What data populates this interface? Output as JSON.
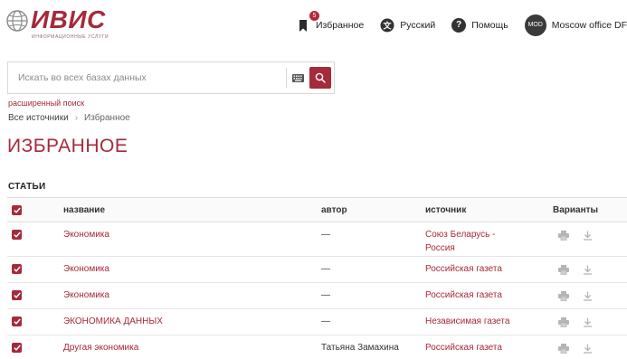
{
  "header": {
    "logo_text": "ИВИС",
    "logo_subtitle": "информационные услуги",
    "favorites_label": "Избранное",
    "favorites_count": "5",
    "language_label": "Русский",
    "help_label": "Помощь",
    "avatar_initials": "MOD",
    "user_label": "Moscow office DF"
  },
  "search": {
    "placeholder": "Искать во всех базах данных",
    "advanced_link": "расширенный поиск"
  },
  "breadcrumb": {
    "root": "Все источники",
    "current": "Избранное"
  },
  "page_title": "ИЗБРАННОЕ",
  "section_title": "СТАТЬИ",
  "table": {
    "columns": {
      "title": "название",
      "author": "автор",
      "source": "источник",
      "variants": "Варианты"
    },
    "rows": [
      {
        "title": "Экономика",
        "author": "—",
        "source": "Союз Беларусь - Россия",
        "checked": true
      },
      {
        "title": "Экономика",
        "author": "—",
        "source": "Российская газета",
        "checked": true
      },
      {
        "title": "Экономика",
        "author": "—",
        "source": "Российская газета",
        "checked": true
      },
      {
        "title": "ЭКОНОМИКА ДАННЫХ",
        "author": "—",
        "source": "Независимая газета",
        "checked": true
      },
      {
        "title": "Другая экономика",
        "author": "Татьяна Замахина",
        "source": "Российская газета",
        "checked": true
      }
    ]
  },
  "colors": {
    "accent": "#a52a3a",
    "badge": "#b3273a"
  }
}
